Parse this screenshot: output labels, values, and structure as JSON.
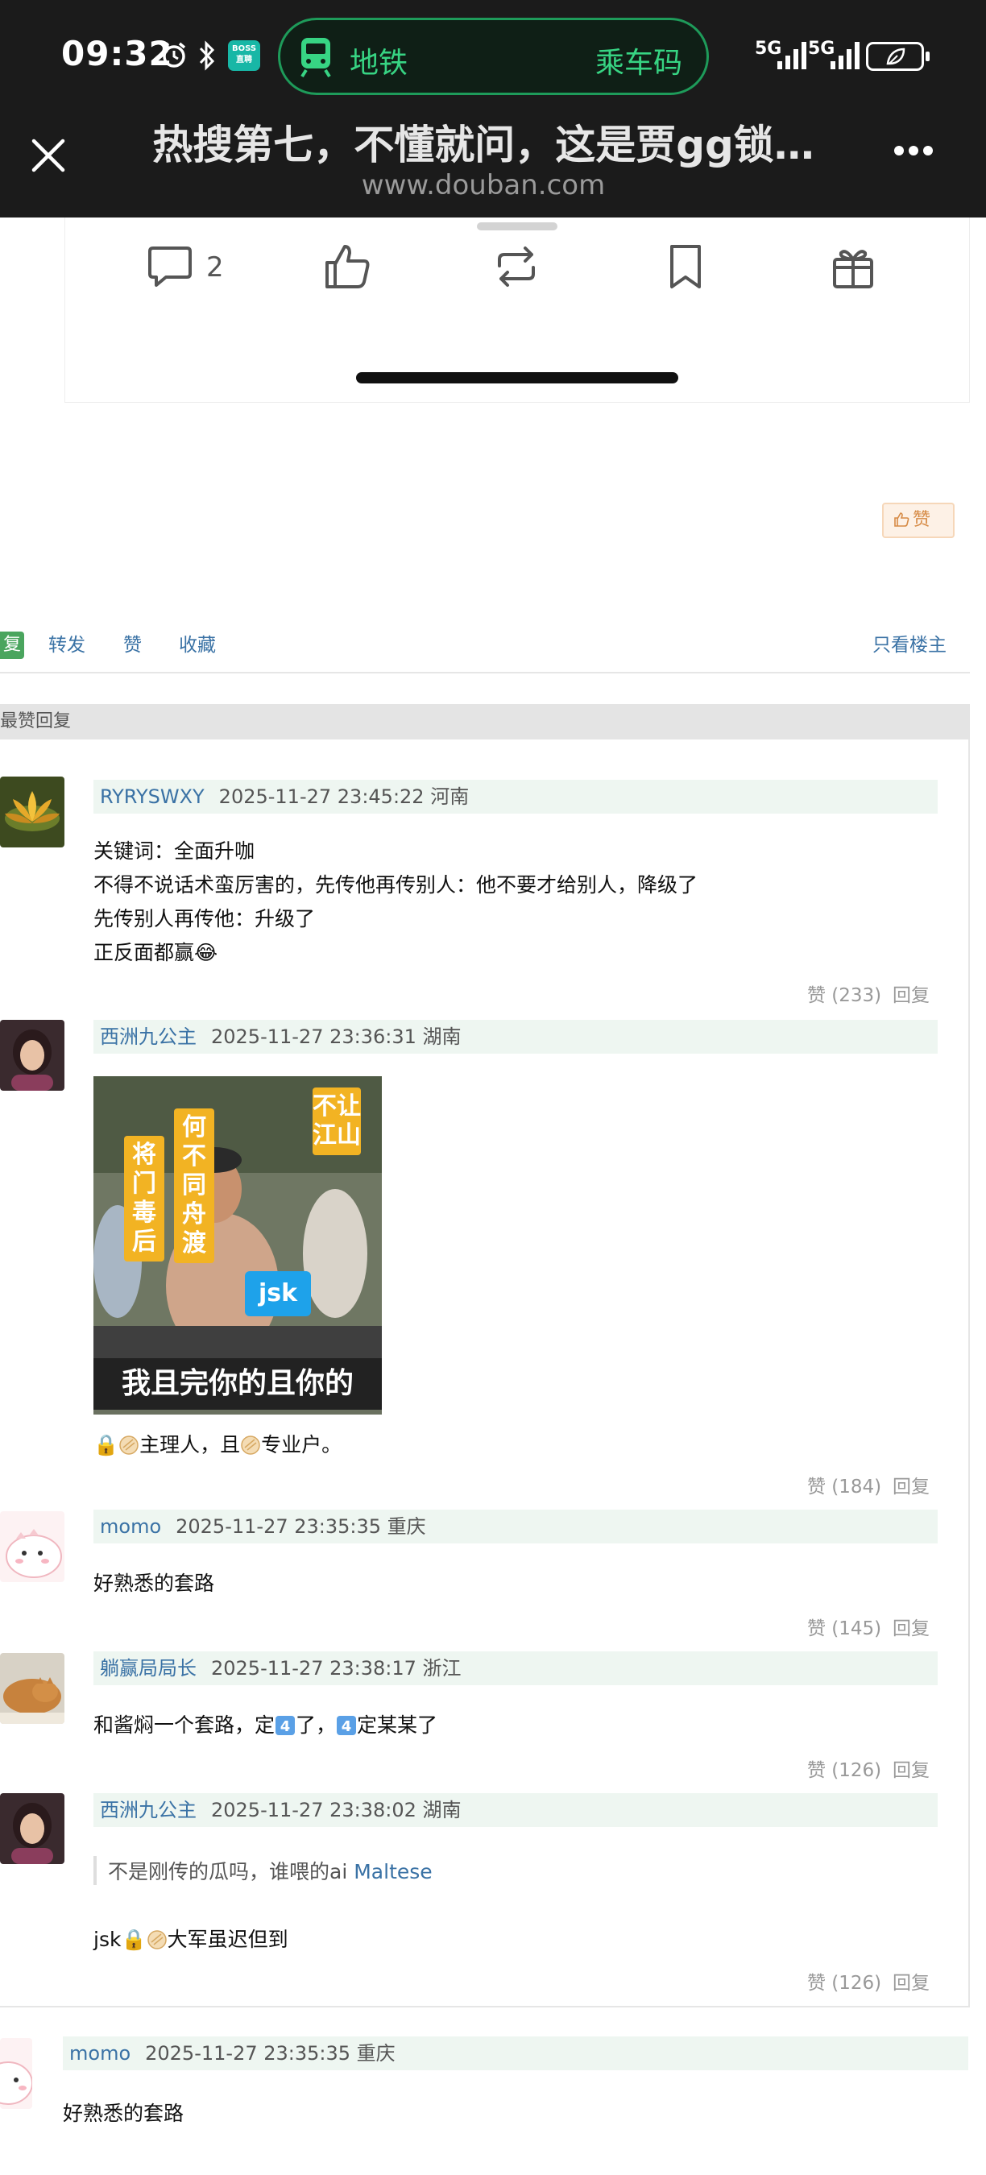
{
  "status_bar": {
    "time": "09:32",
    "boss_badge": "BOSS直聘",
    "metro_label": "地铁",
    "metro_code_label": "乘车码",
    "network_1": "5G",
    "network_2": "5G"
  },
  "header": {
    "title": "热搜第七，不懂就问，这是贾gg锁…",
    "url": "www.douban.com"
  },
  "post_actions": {
    "comment_count": "2"
  },
  "like_chip": "赞",
  "reply_toolbar": {
    "reply_label": "复",
    "forward_label": "转发",
    "like_label": "赞",
    "collect_label": "收藏",
    "only_op_label": "只看楼主"
  },
  "section_title": "最赞回复",
  "comments": [
    {
      "user": "RYRYSWXY",
      "meta": "2025-11-27 23:45:22 河南",
      "lines": [
        "关键词：全面升咖",
        "不得不说话术蛮厉害的，先传他再传别人：他不要才给别人，降级了",
        "先传别人再传他：升级了",
        "正反面都赢😂"
      ],
      "likes": "赞 (233)",
      "reply": "回复"
    },
    {
      "user": "西洲九公主",
      "meta": "2025-11-27 23:36:31 湖南",
      "image": {
        "tags": [
          "将门毒后",
          "何不同舟渡",
          "不让江山"
        ],
        "badge": "jsk",
        "caption": "我且完你的且你的"
      },
      "text_a": "🔒",
      "text_b": "主理人，且",
      "text_c": "专业户。",
      "likes": "赞 (184)",
      "reply": "回复"
    },
    {
      "user": "momo",
      "meta": "2025-11-27 23:35:35 重庆",
      "lines": [
        "好熟悉的套路"
      ],
      "likes": "赞 (145)",
      "reply": "回复"
    },
    {
      "user": "躺赢局局长",
      "meta": "2025-11-27 23:38:17 浙江",
      "text_a": "和酱焖一个套路，定",
      "text_b": "了，",
      "text_c": "定某某了",
      "likes": "赞 (126)",
      "reply": "回复"
    },
    {
      "user": "西洲九公主",
      "meta": "2025-11-27 23:38:02 湖南",
      "quote": "不是刚传的瓜吗，谁喂的ai",
      "quote_mention": "Maltese",
      "text_a": "jsk🔒",
      "text_b": "大军虽迟但到",
      "likes": "赞 (126)",
      "reply": "回复"
    }
  ],
  "trailing_comment": {
    "user": "momo",
    "meta": "2025-11-27 23:35:35 重庆",
    "text": "好熟悉的套路"
  },
  "colors": {
    "link_blue": "#3a72a5",
    "meta_bg": "#eef6f1",
    "metro_green": "#37d483",
    "reply_green": "#4aa55e"
  }
}
